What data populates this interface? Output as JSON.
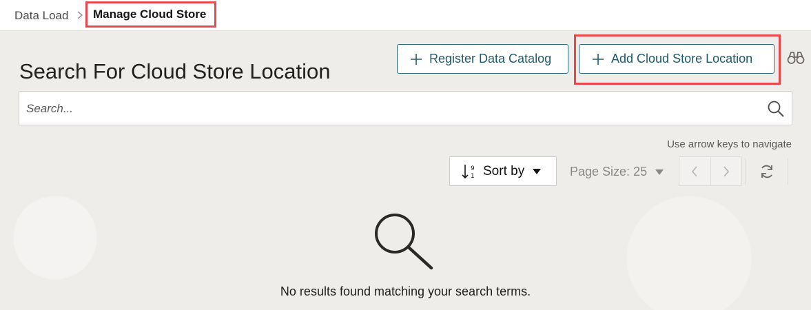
{
  "breadcrumb": {
    "parent": "Data Load",
    "current": "Manage Cloud Store"
  },
  "header": {
    "title": "Search For Cloud Store Location",
    "register_button": "Register Data Catalog",
    "add_button": "Add Cloud Store Location"
  },
  "search": {
    "placeholder": "Search..."
  },
  "toolbar": {
    "nav_hint": "Use arrow keys to navigate",
    "sort_label": "Sort by",
    "page_size_label": "Page Size: 25"
  },
  "empty_state": {
    "message": "No results found matching your search terms."
  },
  "colors": {
    "accent": "#2c6b7f",
    "highlight": "#e8474c"
  },
  "icons": [
    "chevron-right-icon",
    "plus-icon",
    "binoculars-icon",
    "search-icon",
    "sort-icon",
    "caret-down-icon",
    "chevron-left-icon",
    "refresh-icon",
    "magnifier-icon"
  ]
}
